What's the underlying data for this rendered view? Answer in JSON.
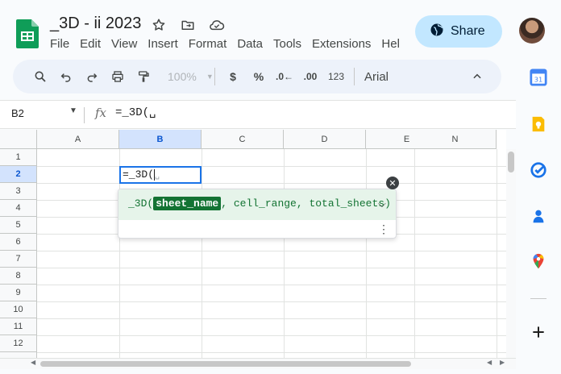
{
  "header": {
    "title": "_3D - ii 2023",
    "menu": [
      "File",
      "Edit",
      "View",
      "Insert",
      "Format",
      "Data",
      "Tools",
      "Extensions",
      "Hel"
    ],
    "share_label": "Share"
  },
  "toolbar": {
    "zoom": "100%",
    "currency": "$",
    "percent": "%",
    "decrease_decimal": ".0←",
    "increase_decimal": ".00",
    "number_format": "123",
    "font": "Arial"
  },
  "formula_bar": {
    "name_box": "B2",
    "fx": "fx",
    "content": "=_3D(␣"
  },
  "grid": {
    "columns": [
      "A",
      "B",
      "C",
      "D",
      "E",
      "N"
    ],
    "rows": [
      "1",
      "2",
      "3",
      "4",
      "5",
      "6",
      "7",
      "8",
      "9",
      "10",
      "11",
      "12"
    ],
    "selected_column": "B",
    "selected_row": "2",
    "editing_cell_text": "=_3D("
  },
  "autocomplete": {
    "function_name": "_3D(",
    "active_param": "sheet_name",
    "rest_params": ", cell_range, total_sheets)"
  },
  "colors": {
    "sheets_green": "#0f9d58",
    "share_bg": "#c2e7ff",
    "selection_blue": "#1a73e8",
    "signature_green": "#137333",
    "signature_bg": "#e6f4ea"
  },
  "icons": {
    "star": "star-icon",
    "move": "folder-move-icon",
    "cloud": "cloud-status-icon",
    "globe": "globe-icon",
    "calendar": "calendar-icon",
    "keep": "keep-icon",
    "tasks": "tasks-icon",
    "contacts": "contacts-icon",
    "maps": "maps-icon",
    "add": "plus-icon"
  }
}
